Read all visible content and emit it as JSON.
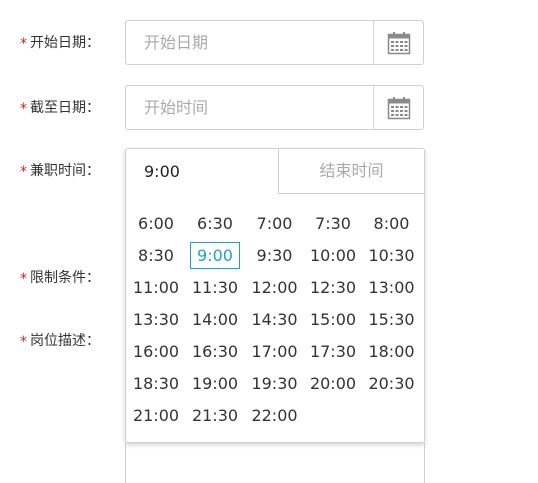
{
  "form": {
    "start_date": {
      "label": "开始日期",
      "colon": "：",
      "placeholder": "开始日期"
    },
    "end_date": {
      "label": "截至日期",
      "colon": "：",
      "placeholder": "开始时间"
    },
    "work_time": {
      "label": "兼职时间",
      "colon": "：",
      "start_value": "9:00",
      "end_placeholder": "结束时间"
    },
    "restrictions": {
      "label": "限制条件",
      "colon": "："
    },
    "job_desc": {
      "label": "岗位描述",
      "colon": "："
    },
    "required_mark": "*"
  },
  "time_slots": [
    "6:00",
    "6:30",
    "7:00",
    "7:30",
    "8:00",
    "8:30",
    "9:00",
    "9:30",
    "10:00",
    "10:30",
    "11:00",
    "11:30",
    "12:00",
    "12:30",
    "13:00",
    "13:30",
    "14:00",
    "14:30",
    "15:00",
    "15:30",
    "16:00",
    "16:30",
    "17:00",
    "17:30",
    "18:00",
    "18:30",
    "19:00",
    "19:30",
    "20:00",
    "20:30",
    "21:00",
    "21:30",
    "22:00"
  ],
  "selected_slot": "9:00",
  "colors": {
    "required": "#e02020",
    "accent": "#1aa3c4",
    "placeholder": "#aaaaaa"
  },
  "icons": {
    "calendar": "calendar-icon"
  }
}
